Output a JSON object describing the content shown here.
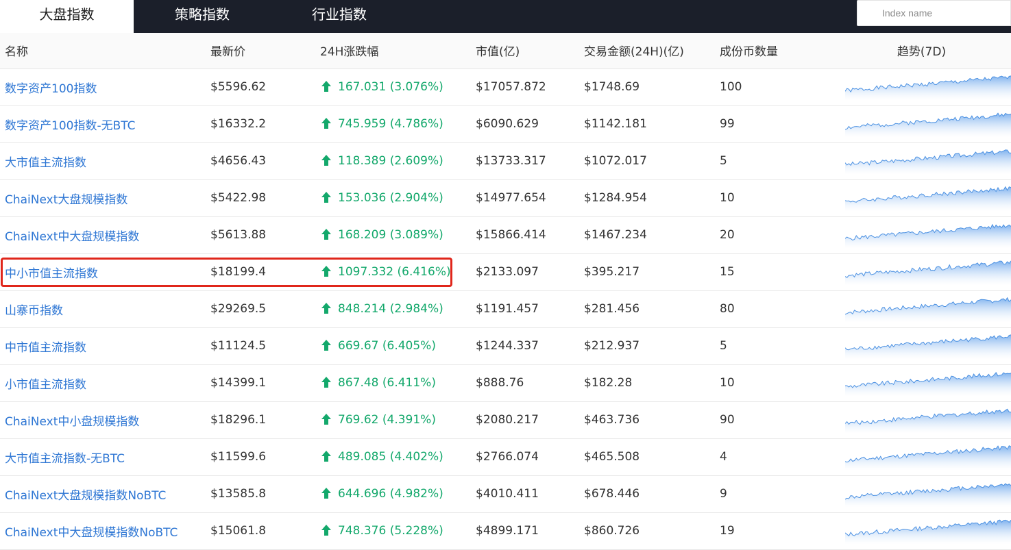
{
  "tabs": [
    {
      "label": "大盘指数",
      "active": true
    },
    {
      "label": "策略指数",
      "active": false
    },
    {
      "label": "行业指数",
      "active": false
    }
  ],
  "search": {
    "placeholder": "Index name"
  },
  "columns": [
    "名称",
    "最新价",
    "24H涨跌幅",
    "市值(亿)",
    "交易金额(24H)(亿)",
    "成份币数量",
    "趋势(7D)"
  ],
  "colors": {
    "link": "#2f77d4",
    "up": "#13a86b",
    "highlight": "#e0261b",
    "spark_line": "#4a90e2"
  },
  "rows": [
    {
      "name": "数字资产100指数",
      "price": "$5596.62",
      "change": "167.031 (3.076%)",
      "cap": "$17057.872",
      "volume": "$1748.69",
      "count": "100"
    },
    {
      "name": "数字资产100指数-无BTC",
      "price": "$16332.2",
      "change": "745.959 (4.786%)",
      "cap": "$6090.629",
      "volume": "$1142.181",
      "count": "99"
    },
    {
      "name": "大市值主流指数",
      "price": "$4656.43",
      "change": "118.389 (2.609%)",
      "cap": "$13733.317",
      "volume": "$1072.017",
      "count": "5"
    },
    {
      "name": "ChaiNext大盘规模指数",
      "price": "$5422.98",
      "change": "153.036 (2.904%)",
      "cap": "$14977.654",
      "volume": "$1284.954",
      "count": "10"
    },
    {
      "name": "ChaiNext中大盘规模指数",
      "price": "$5613.88",
      "change": "168.209 (3.089%)",
      "cap": "$15866.414",
      "volume": "$1467.234",
      "count": "20"
    },
    {
      "name": "中小市值主流指数",
      "price": "$18199.4",
      "change": "1097.332 (6.416%)",
      "cap": "$2133.097",
      "volume": "$395.217",
      "count": "15",
      "highlighted": true
    },
    {
      "name": "山寨币指数",
      "price": "$29269.5",
      "change": "848.214 (2.984%)",
      "cap": "$1191.457",
      "volume": "$281.456",
      "count": "80"
    },
    {
      "name": "中市值主流指数",
      "price": "$11124.5",
      "change": "669.67 (6.405%)",
      "cap": "$1244.337",
      "volume": "$212.937",
      "count": "5"
    },
    {
      "name": "小市值主流指数",
      "price": "$14399.1",
      "change": "867.48 (6.411%)",
      "cap": "$888.76",
      "volume": "$182.28",
      "count": "10"
    },
    {
      "name": "ChaiNext中小盘规模指数",
      "price": "$18296.1",
      "change": "769.62 (4.391%)",
      "cap": "$2080.217",
      "volume": "$463.736",
      "count": "90"
    },
    {
      "name": "大市值主流指数-无BTC",
      "price": "$11599.6",
      "change": "489.085 (4.402%)",
      "cap": "$2766.074",
      "volume": "$465.508",
      "count": "4"
    },
    {
      "name": "ChaiNext大盘规模指数NoBTC",
      "price": "$13585.8",
      "change": "644.696 (4.982%)",
      "cap": "$4010.411",
      "volume": "$678.446",
      "count": "9"
    },
    {
      "name": "ChaiNext中大盘规模指数NoBTC",
      "price": "$15061.8",
      "change": "748.376 (5.228%)",
      "cap": "$4899.171",
      "volume": "$860.726",
      "count": "19"
    }
  ]
}
